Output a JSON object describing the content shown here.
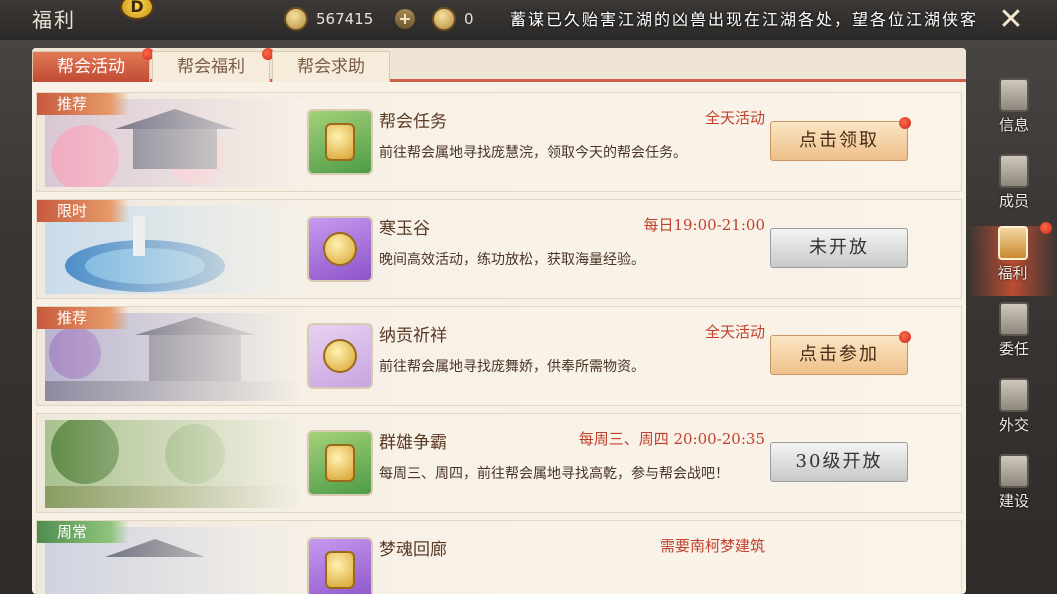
{
  "header": {
    "title": "福利",
    "badge_glyph": "D",
    "copper_value": "567415",
    "gold_value": "0",
    "plus_label": "+",
    "marquee": "蓄谋已久贻害江湖的凶兽出现在江湖各处，望各位江湖侠客",
    "close_label": "✕"
  },
  "tabs": [
    {
      "label": "帮会活动",
      "active": true
    },
    {
      "label": "帮会福利",
      "active": false
    },
    {
      "label": "帮会求助",
      "active": false
    }
  ],
  "activities": [
    {
      "tag": "推荐",
      "tag_color": "red",
      "icon": "guild-token-icon",
      "icon_bg": "green",
      "name": "帮会任务",
      "time": "全天活动",
      "desc": "前往帮会属地寻找庞慧浣，领取今天的帮会任务。",
      "button": "点击领取",
      "button_style": "gold"
    },
    {
      "tag": "限时",
      "tag_color": "red",
      "icon": "coin-medal-icon",
      "icon_bg": "purple",
      "name": "寒玉谷",
      "time": "每日19:00-21:00",
      "desc": "晚间高效活动，练功放松，获取海量经验。",
      "button": "未开放",
      "button_style": "gray"
    },
    {
      "tag": "推荐",
      "tag_color": "red",
      "icon": "coin-medal-icon",
      "icon_bg": "lilac",
      "name": "纳贡祈祥",
      "time": "全天活动",
      "desc": "前往帮会属地寻找庞舞娇，供奉所需物资。",
      "button": "点击参加",
      "button_style": "gold"
    },
    {
      "tag": "",
      "tag_color": "",
      "icon": "guild-token-icon",
      "icon_bg": "green",
      "name": "群雄争霸",
      "time": "每周三、周四 20:00-20:35",
      "desc": "每周三、周四，前往帮会属地寻找高乾，参与帮会战吧！",
      "button": "30级开放",
      "button_style": "gray"
    },
    {
      "tag": "周常",
      "tag_color": "green",
      "icon": "scroll-icon",
      "icon_bg": "purple",
      "name": "梦魂回廊",
      "time": "需要南柯梦建筑",
      "desc": "",
      "button": "",
      "button_style": "gray"
    }
  ],
  "nav": [
    {
      "label": "信息",
      "icon": "info-banner-icon",
      "active": false
    },
    {
      "label": "成员",
      "icon": "members-banner-icon",
      "active": false
    },
    {
      "label": "福利",
      "icon": "welfare-banner-icon",
      "active": true
    },
    {
      "label": "委任",
      "icon": "appoint-banner-icon",
      "active": false
    },
    {
      "label": "外交",
      "icon": "diplomacy-banner-icon",
      "active": false
    },
    {
      "label": "建设",
      "icon": "build-banner-icon",
      "active": false
    }
  ],
  "colors": {
    "accent_red": "#c0412e",
    "tab_active": "#d0603f",
    "panel_bg": "#f7f1e6"
  }
}
